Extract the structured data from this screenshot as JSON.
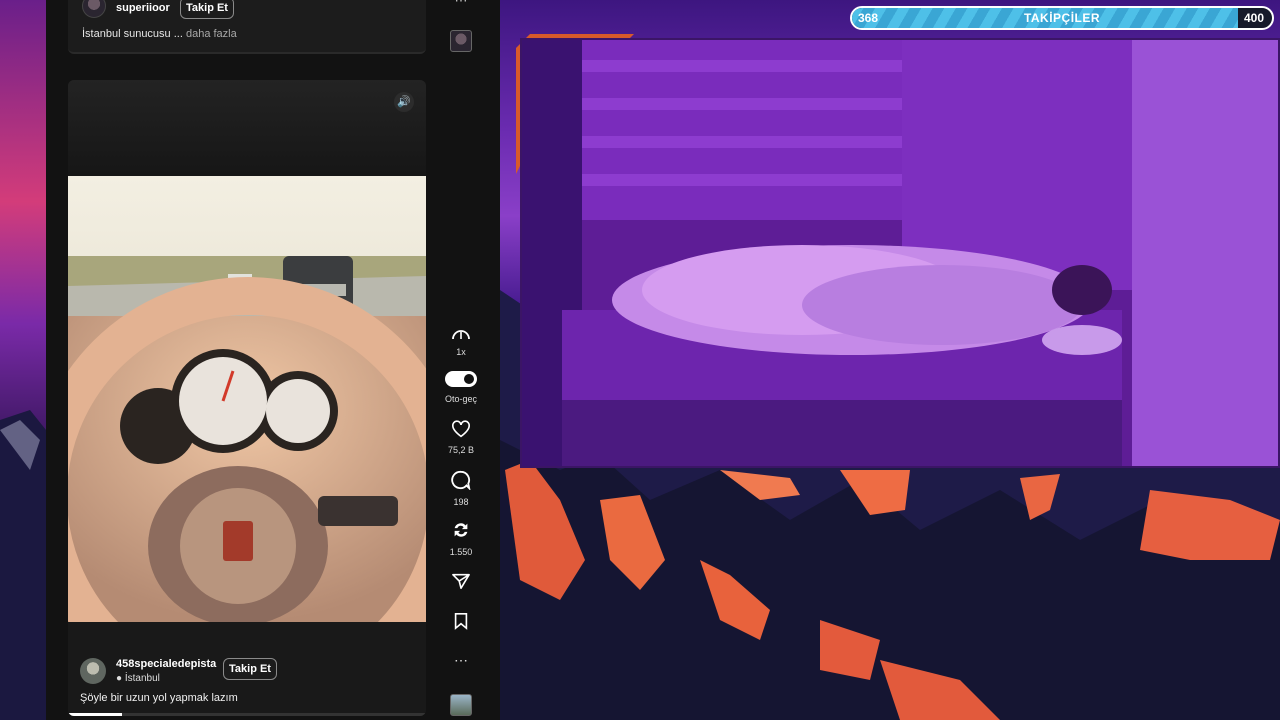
{
  "top_post": {
    "username": "superiioor",
    "follow_label": "Takip Et",
    "caption": "İstanbul sunucusu ...",
    "more_label": "daha fazla"
  },
  "video_post": {
    "username": "458specialedepista",
    "location": "İstanbul",
    "follow_label": "Takip Et",
    "caption": "Şöyle bir uzun yol yapmak lazım",
    "progress_fraction": 0.15
  },
  "rail": {
    "speed_label": "1x",
    "autoplay_label": "Oto-geç",
    "likes": "75,2 B",
    "comments": "198",
    "reposts": "1.550",
    "more_glyph": "⋯"
  },
  "follower_goal": {
    "current": "368",
    "title": "TAKİPÇİLER",
    "target": "400",
    "fraction": 0.92
  },
  "icons": {
    "volume": "volume-icon",
    "speed": "gauge-icon",
    "like": "heart-icon",
    "comment": "comment-icon",
    "repost": "repost-icon",
    "share": "share-icon",
    "bookmark": "bookmark-icon"
  }
}
